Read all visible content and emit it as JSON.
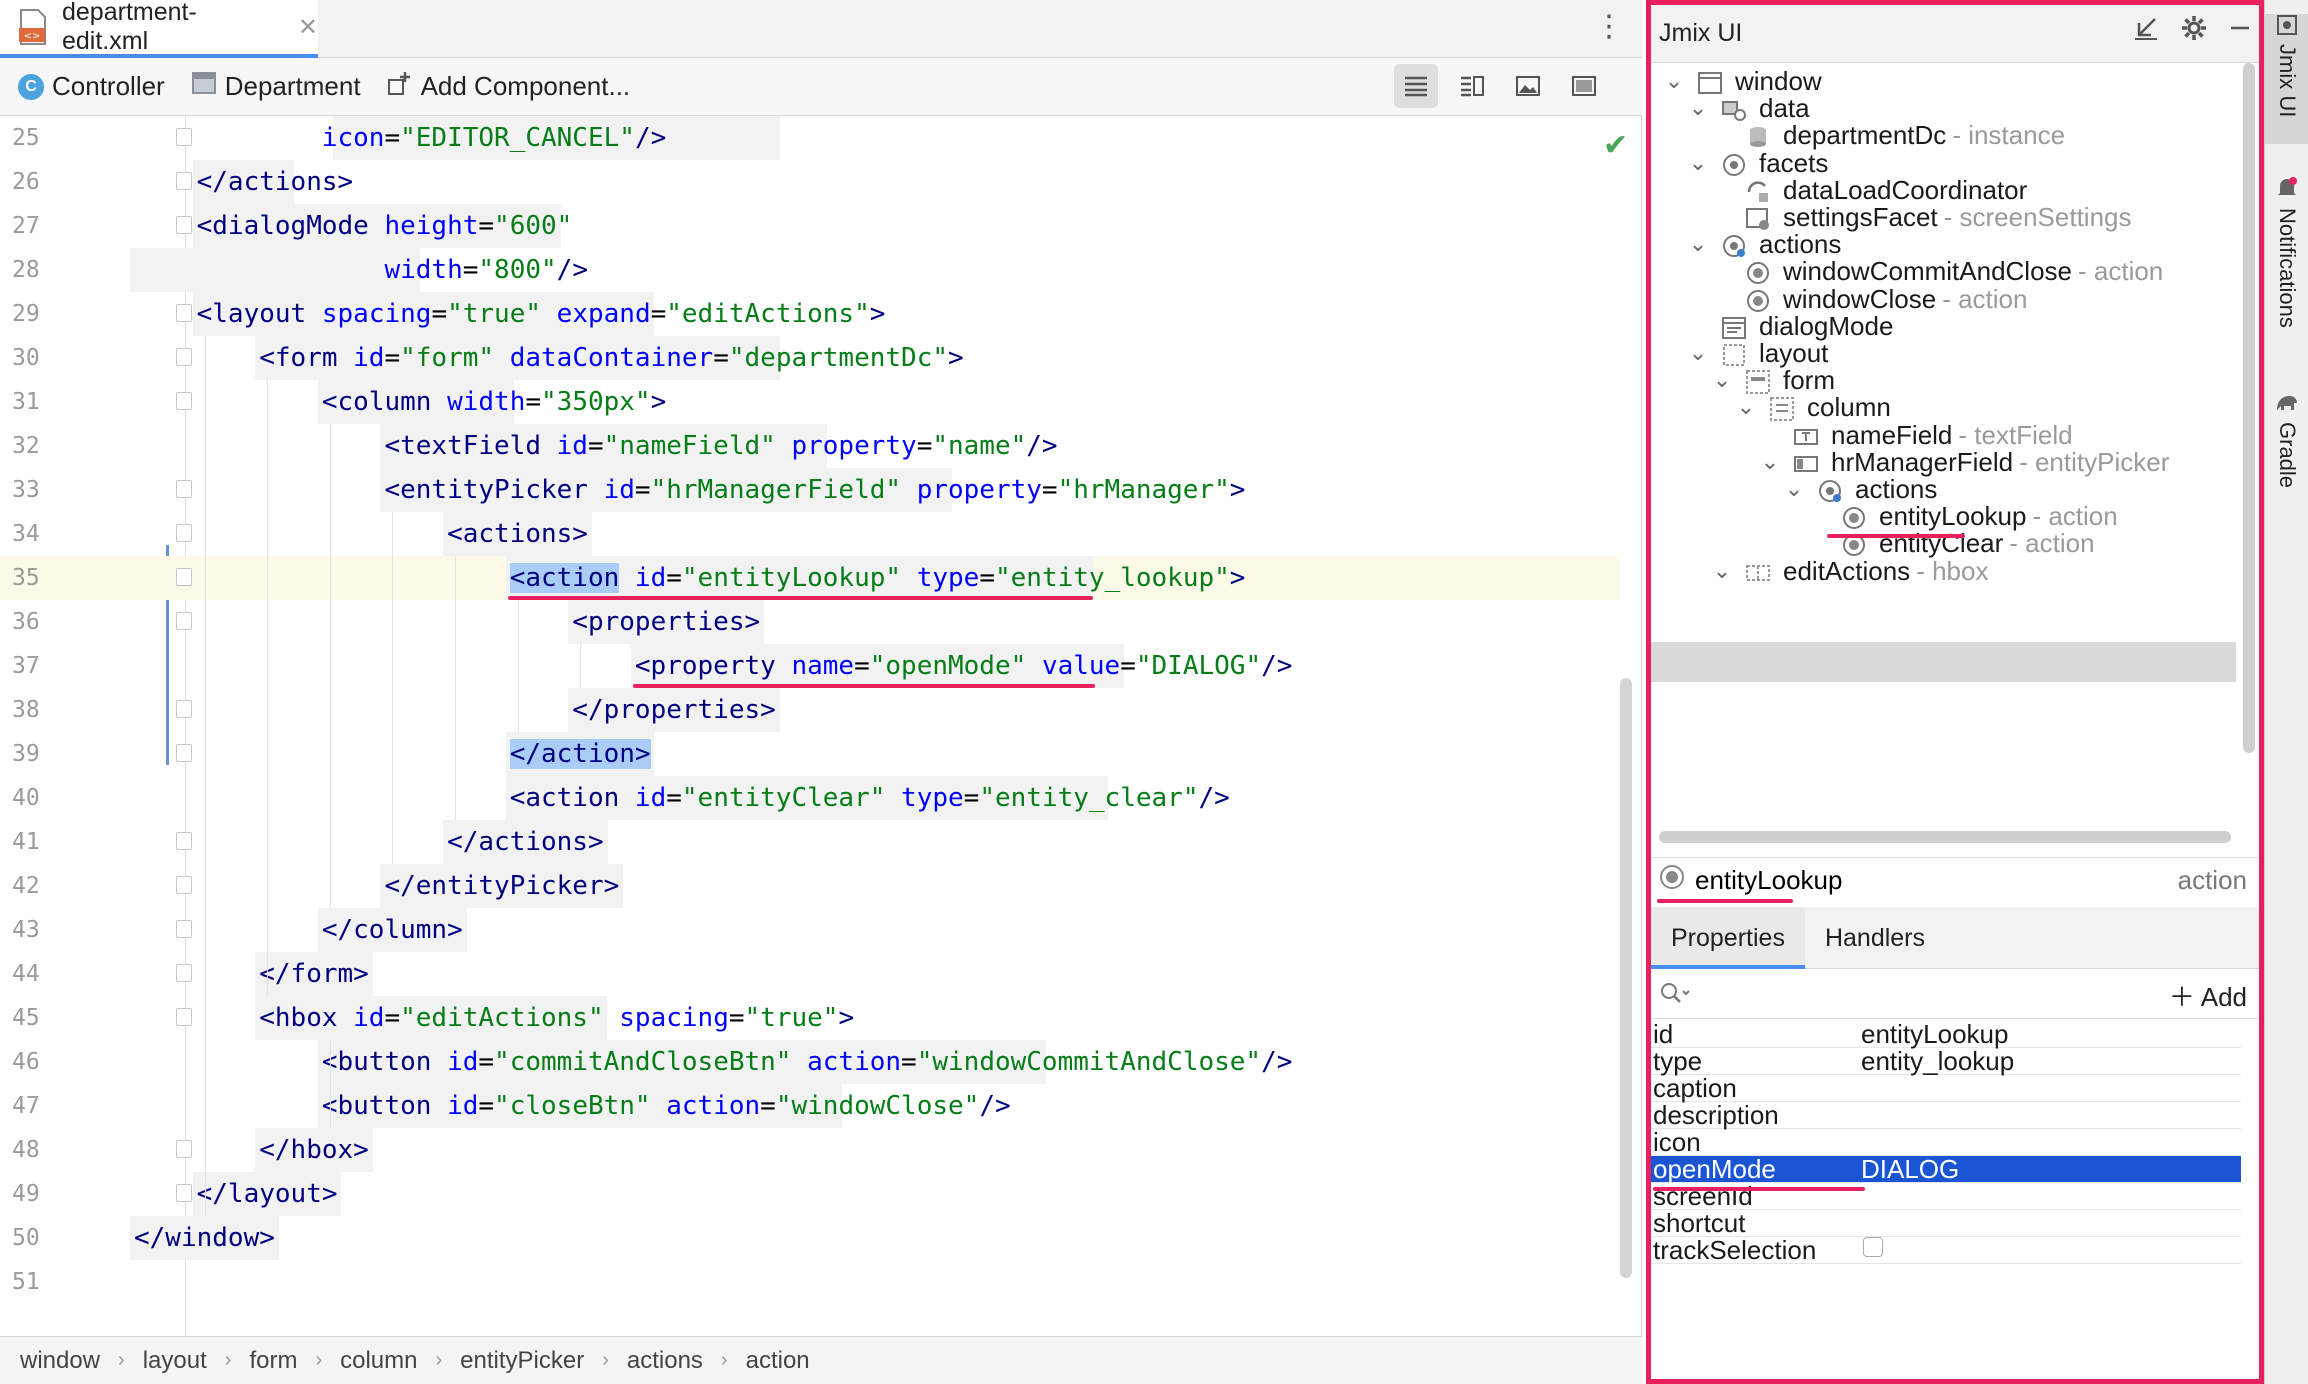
{
  "editor": {
    "tab_title": "department-edit.xml",
    "tab_close": "✕",
    "menu_glyph": "⋮",
    "toolbar": {
      "controller": "Controller",
      "department": "Department",
      "add_component": "Add Component..."
    },
    "lines": [
      {
        "n": "25",
        "parts": [
          [
            "",
            "            "
          ],
          [
            "attr",
            "icon"
          ],
          [
            "",
            "="
          ],
          [
            "val",
            "\"EDITOR_CANCEL\""
          ],
          [
            "tag",
            "/>"
          ]
        ]
      },
      {
        "n": "26",
        "parts": [
          [
            "",
            "    "
          ],
          [
            "tag",
            "</actions>"
          ]
        ]
      },
      {
        "n": "27",
        "parts": [
          [
            "",
            "    "
          ],
          [
            "tag",
            "<dialogMode "
          ],
          [
            "attr",
            "height"
          ],
          [
            "",
            "="
          ],
          [
            "val",
            "\"600\""
          ]
        ]
      },
      {
        "n": "28",
        "parts": [
          [
            "",
            "                "
          ],
          [
            "attr",
            "width"
          ],
          [
            "",
            "="
          ],
          [
            "val",
            "\"800\""
          ],
          [
            "tag",
            "/>"
          ]
        ]
      },
      {
        "n": "29",
        "parts": [
          [
            "",
            "    "
          ],
          [
            "tag",
            "<layout "
          ],
          [
            "attr",
            "spacing"
          ],
          [
            "",
            "="
          ],
          [
            "val",
            "\"true\""
          ],
          [
            "",
            " "
          ],
          [
            "attr",
            "expand"
          ],
          [
            "",
            "="
          ],
          [
            "val",
            "\"editActions\""
          ],
          [
            "tag",
            ">"
          ]
        ]
      },
      {
        "n": "30",
        "parts": [
          [
            "",
            "        "
          ],
          [
            "tag",
            "<form "
          ],
          [
            "attr",
            "id"
          ],
          [
            "",
            "="
          ],
          [
            "val",
            "\"form\""
          ],
          [
            "",
            " "
          ],
          [
            "attr",
            "dataContainer"
          ],
          [
            "",
            "="
          ],
          [
            "val",
            "\"departmentDc\""
          ],
          [
            "tag",
            ">"
          ]
        ]
      },
      {
        "n": "31",
        "parts": [
          [
            "",
            "            "
          ],
          [
            "tag",
            "<column "
          ],
          [
            "attr",
            "width"
          ],
          [
            "",
            "="
          ],
          [
            "val",
            "\"350px\""
          ],
          [
            "tag",
            ">"
          ]
        ]
      },
      {
        "n": "32",
        "parts": [
          [
            "",
            "                "
          ],
          [
            "tag",
            "<textField "
          ],
          [
            "attr",
            "id"
          ],
          [
            "",
            "="
          ],
          [
            "val",
            "\"nameField\""
          ],
          [
            "",
            " "
          ],
          [
            "attr",
            "property"
          ],
          [
            "",
            "="
          ],
          [
            "val",
            "\"name\""
          ],
          [
            "tag",
            "/>"
          ]
        ]
      },
      {
        "n": "33",
        "parts": [
          [
            "",
            "                "
          ],
          [
            "tag",
            "<entityPicker "
          ],
          [
            "attr",
            "id"
          ],
          [
            "",
            "="
          ],
          [
            "val",
            "\"hrManagerField\""
          ],
          [
            "",
            " "
          ],
          [
            "attr",
            "property"
          ],
          [
            "",
            "="
          ],
          [
            "val",
            "\"hrManager\""
          ],
          [
            "tag",
            ">"
          ]
        ]
      },
      {
        "n": "34",
        "parts": [
          [
            "",
            "                    "
          ],
          [
            "tag",
            "<actions>"
          ]
        ]
      },
      {
        "n": "35",
        "parts": [
          [
            "",
            "                        "
          ],
          [
            "sel",
            "<action"
          ],
          [
            "",
            " "
          ],
          [
            "attr",
            "id"
          ],
          [
            "",
            "="
          ],
          [
            "val",
            "\"entityLookup\""
          ],
          [
            "",
            " "
          ],
          [
            "attr",
            "type"
          ],
          [
            "",
            "="
          ],
          [
            "val",
            "\"entity_lookup\""
          ],
          [
            "tag",
            ">"
          ]
        ]
      },
      {
        "n": "36",
        "parts": [
          [
            "",
            "                            "
          ],
          [
            "tag",
            "<properties>"
          ]
        ]
      },
      {
        "n": "37",
        "parts": [
          [
            "",
            "                                "
          ],
          [
            "tag",
            "<property "
          ],
          [
            "attr",
            "name"
          ],
          [
            "",
            "="
          ],
          [
            "val",
            "\"openMode\""
          ],
          [
            "",
            " "
          ],
          [
            "attr",
            "value"
          ],
          [
            "",
            "="
          ],
          [
            "val",
            "\"DIALOG\""
          ],
          [
            "tag",
            "/>"
          ]
        ]
      },
      {
        "n": "38",
        "parts": [
          [
            "",
            "                            "
          ],
          [
            "tag",
            "</properties>"
          ]
        ]
      },
      {
        "n": "39",
        "parts": [
          [
            "",
            "                        "
          ],
          [
            "sel",
            "</action>"
          ]
        ]
      },
      {
        "n": "40",
        "parts": [
          [
            "",
            "                        "
          ],
          [
            "tag",
            "<action "
          ],
          [
            "attr",
            "id"
          ],
          [
            "",
            "="
          ],
          [
            "val",
            "\"entityClear\""
          ],
          [
            "",
            " "
          ],
          [
            "attr",
            "type"
          ],
          [
            "",
            "="
          ],
          [
            "val",
            "\"entity_clear\""
          ],
          [
            "tag",
            "/>"
          ]
        ]
      },
      {
        "n": "41",
        "parts": [
          [
            "",
            "                    "
          ],
          [
            "tag",
            "</actions>"
          ]
        ]
      },
      {
        "n": "42",
        "parts": [
          [
            "",
            "                "
          ],
          [
            "tag",
            "</entityPicker>"
          ]
        ]
      },
      {
        "n": "43",
        "parts": [
          [
            "",
            "            "
          ],
          [
            "tag",
            "</column>"
          ]
        ]
      },
      {
        "n": "44",
        "parts": [
          [
            "",
            "        "
          ],
          [
            "tag",
            "</form>"
          ]
        ]
      },
      {
        "n": "45",
        "parts": [
          [
            "",
            "        "
          ],
          [
            "tag",
            "<hbox "
          ],
          [
            "attr",
            "id"
          ],
          [
            "",
            "="
          ],
          [
            "val",
            "\"editActions\""
          ],
          [
            "",
            " "
          ],
          [
            "attr",
            "spacing"
          ],
          [
            "",
            "="
          ],
          [
            "val",
            "\"true\""
          ],
          [
            "tag",
            ">"
          ]
        ]
      },
      {
        "n": "46",
        "parts": [
          [
            "",
            "            "
          ],
          [
            "tag",
            "<button "
          ],
          [
            "attr",
            "id"
          ],
          [
            "",
            "="
          ],
          [
            "val",
            "\"commitAndCloseBtn\""
          ],
          [
            "",
            " "
          ],
          [
            "attr",
            "action"
          ],
          [
            "",
            "="
          ],
          [
            "val",
            "\"windowCommitAndClose\""
          ],
          [
            "tag",
            "/>"
          ]
        ]
      },
      {
        "n": "47",
        "parts": [
          [
            "",
            "            "
          ],
          [
            "tag",
            "<button "
          ],
          [
            "attr",
            "id"
          ],
          [
            "",
            "="
          ],
          [
            "val",
            "\"closeBtn\""
          ],
          [
            "",
            " "
          ],
          [
            "attr",
            "action"
          ],
          [
            "",
            "="
          ],
          [
            "val",
            "\"windowClose\""
          ],
          [
            "tag",
            "/>"
          ]
        ]
      },
      {
        "n": "48",
        "parts": [
          [
            "",
            "        "
          ],
          [
            "tag",
            "</hbox>"
          ]
        ]
      },
      {
        "n": "49",
        "parts": [
          [
            "",
            "    "
          ],
          [
            "tag",
            "</layout>"
          ]
        ]
      },
      {
        "n": "50",
        "parts": [
          [
            "tag",
            "</window>"
          ]
        ]
      },
      {
        "n": "51",
        "parts": []
      }
    ],
    "breadcrumb": [
      "window",
      "layout",
      "form",
      "column",
      "entityPicker",
      "actions",
      "action"
    ],
    "breadcrumb_sep": "›"
  },
  "jmix": {
    "title": "Jmix UI",
    "tree": [
      {
        "label": "window",
        "hint": "",
        "icon": "window-icon"
      },
      {
        "label": "data",
        "hint": "",
        "icon": "data-icon"
      },
      {
        "label": "departmentDc",
        "hint": "- instance",
        "icon": "database-icon"
      },
      {
        "label": "facets",
        "hint": "",
        "icon": "facets-icon"
      },
      {
        "label": "dataLoadCoordinator",
        "hint": "",
        "icon": "coordinator-icon"
      },
      {
        "label": "settingsFacet",
        "hint": "- screenSettings",
        "icon": "settings-facet-icon"
      },
      {
        "label": "actions",
        "hint": "",
        "icon": "actions-icon"
      },
      {
        "label": "windowCommitAndClose",
        "hint": "- action",
        "icon": "action-icon"
      },
      {
        "label": "windowClose",
        "hint": "- action",
        "icon": "action-icon"
      },
      {
        "label": "dialogMode",
        "hint": "",
        "icon": "dialog-icon"
      },
      {
        "label": "layout",
        "hint": "",
        "icon": "layout-icon"
      },
      {
        "label": "form",
        "hint": "",
        "icon": "form-icon"
      },
      {
        "label": "column",
        "hint": "",
        "icon": "column-icon"
      },
      {
        "label": "nameField",
        "hint": "- textField",
        "icon": "textfield-icon"
      },
      {
        "label": "hrManagerField",
        "hint": "- entityPicker",
        "icon": "picker-icon"
      },
      {
        "label": "actions",
        "hint": "",
        "icon": "actions-icon"
      },
      {
        "label": "entityLookup",
        "hint": "- action",
        "icon": "action-icon"
      },
      {
        "label": "entityClear",
        "hint": "- action",
        "icon": "action-icon"
      },
      {
        "label": "editActions",
        "hint": "- hbox",
        "icon": "hbox-icon"
      }
    ],
    "selected": {
      "name": "entityLookup",
      "type": "action"
    },
    "tabs": [
      "Properties",
      "Handlers"
    ],
    "search_placeholder": "",
    "add_label": "Add",
    "properties": [
      {
        "name": "id",
        "value": "entityLookup"
      },
      {
        "name": "type",
        "value": "entity_lookup"
      },
      {
        "name": "caption",
        "value": ""
      },
      {
        "name": "description",
        "value": ""
      },
      {
        "name": "icon",
        "value": ""
      },
      {
        "name": "openMode",
        "value": "DIALOG"
      },
      {
        "name": "screenId",
        "value": ""
      },
      {
        "name": "shortcut",
        "value": ""
      },
      {
        "name": "trackSelection",
        "value": ""
      }
    ]
  },
  "side_strip": {
    "tabs": [
      "Jmix UI",
      "Notifications",
      "Gradle"
    ]
  },
  "colors": {
    "highlight": "#e8205e",
    "selection": "#1c55d4",
    "tag": "#000080",
    "attr": "#0000ff",
    "value": "#067d17"
  }
}
